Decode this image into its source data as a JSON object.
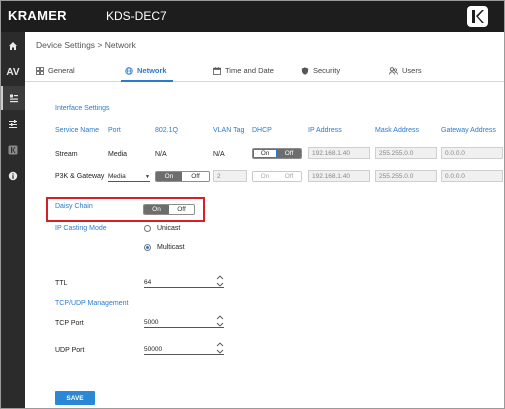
{
  "app": {
    "brand": "KRAMER",
    "product": "KDS-DEC7"
  },
  "sidebar": {
    "items": [
      {
        "name": "home-icon"
      },
      {
        "name": "av-icon",
        "label": "AV"
      },
      {
        "name": "device-settings-icon"
      },
      {
        "name": "tuning-icon"
      },
      {
        "name": "k-logo-icon"
      },
      {
        "name": "info-icon"
      }
    ]
  },
  "breadcrumb": "Device Settings > Network",
  "tabs": [
    {
      "label": "General",
      "icon": "grid-icon"
    },
    {
      "label": "Network",
      "icon": "network-icon",
      "active": true
    },
    {
      "label": "Time and Date",
      "icon": "calendar-icon"
    },
    {
      "label": "Security",
      "icon": "shield-icon"
    },
    {
      "label": "Users",
      "icon": "users-icon"
    }
  ],
  "interface_settings": {
    "title": "Interface Settings",
    "columns": [
      "Service Name",
      "Port",
      "802.1Q",
      "VLAN Tag",
      "DHCP",
      "IP Address",
      "Mask Address",
      "Gateway Address"
    ],
    "rows": [
      {
        "service": "Stream",
        "port": "Media",
        "q8021": "N/A",
        "vlan_tag": "N/A",
        "dhcp_on": "On",
        "dhcp_off": "Off",
        "ip": "192.168.1.40",
        "mask": "255.255.0.0",
        "gateway": "0.0.0.0"
      },
      {
        "service": "P3K & Gateway",
        "port": "Media",
        "q8021_on": "On",
        "q8021_off": "Off",
        "vlan_tag": "2",
        "dhcp_on": "On",
        "dhcp_off": "Off",
        "ip": "192.168.1.40",
        "mask": "255.255.0.0",
        "gateway": "0.0.0.0"
      }
    ]
  },
  "daisy_chain": {
    "label": "Daisy Chain",
    "on": "On",
    "off": "Off",
    "value": "Off"
  },
  "ip_casting": {
    "label": "IP Casting Mode",
    "options": [
      "Unicast",
      "Multicast"
    ],
    "selected": "Multicast"
  },
  "ttl": {
    "label": "TTL",
    "value": "64"
  },
  "tcp_udp": {
    "title": "TCP/UDP Management",
    "tcp_label": "TCP Port",
    "tcp_value": "5000",
    "udp_label": "UDP Port",
    "udp_value": "50000"
  },
  "save_label": "SAVE",
  "colors": {
    "accent": "#2a7bd0",
    "topbar": "#1d1d1d",
    "sidebar": "#2b2b2b",
    "highlight": "#d61f26",
    "save": "#2a88d6"
  }
}
